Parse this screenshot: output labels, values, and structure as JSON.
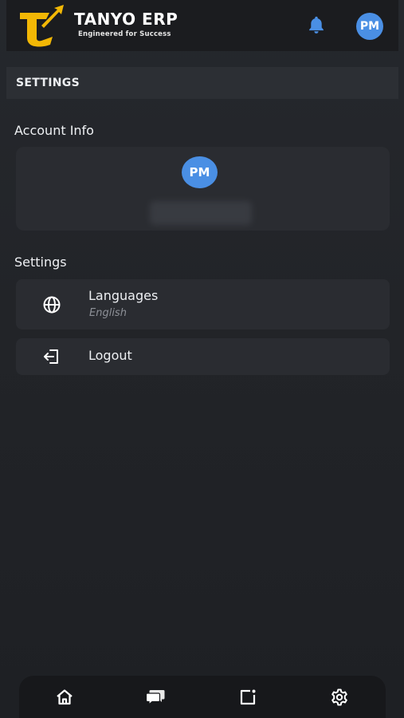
{
  "header": {
    "brand_name": "TANYO ERP",
    "brand_tagline": "Engineered for Success",
    "avatar_initials": "PM",
    "accent_color": "#f2b705",
    "avatar_color": "#4a8fe4"
  },
  "page": {
    "section_title": "SETTINGS"
  },
  "account": {
    "title": "Account Info",
    "avatar_initials": "PM",
    "name_hidden": true
  },
  "settings": {
    "title": "Settings",
    "items": [
      {
        "icon": "globe-icon",
        "label": "Languages",
        "value": "English"
      },
      {
        "icon": "logout-icon",
        "label": "Logout"
      }
    ]
  },
  "bottom_nav": {
    "items": [
      {
        "icon": "home-icon"
      },
      {
        "icon": "chat-icon"
      },
      {
        "icon": "notes-icon"
      },
      {
        "icon": "gear-icon"
      }
    ]
  }
}
